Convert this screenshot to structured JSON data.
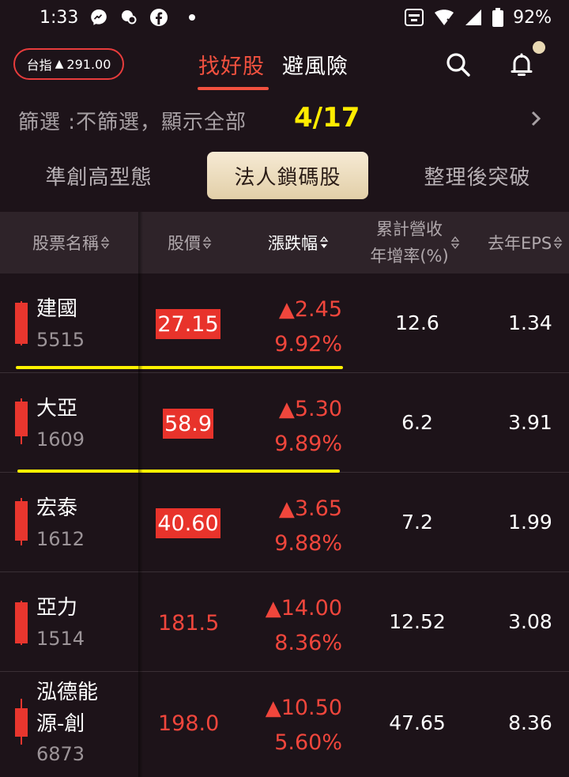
{
  "status_bar": {
    "time": "1:33",
    "battery": "92%"
  },
  "top_nav": {
    "index_label": "台指",
    "index_arrow": "▲",
    "index_value": "291.00",
    "tabs": [
      {
        "label": "找好股",
        "active": true
      },
      {
        "label": "避風險",
        "active": false
      }
    ]
  },
  "filter": {
    "label": "篩選 :不篩選，顯示全部",
    "date": "4/17"
  },
  "sub_tabs": [
    {
      "label": "準創高型態",
      "active": false
    },
    {
      "label": "法人鎖碼股",
      "active": true
    },
    {
      "label": "整理後突破",
      "active": false
    }
  ],
  "table": {
    "headers": {
      "name": "股票名稱",
      "price": "股價",
      "change": "漲跌幅",
      "revenue_line1": "累計營收",
      "revenue_line2": "年增率(%)",
      "eps": "去年EPS"
    },
    "rows": [
      {
        "name": "建國",
        "code": "5515",
        "price": "27.15",
        "price_limit_up": true,
        "change": "2.45",
        "change_pct": "9.92%",
        "revenue_growth": "12.6",
        "eps": "1.34"
      },
      {
        "name": "大亞",
        "code": "1609",
        "price": "58.9",
        "price_limit_up": true,
        "change": "5.30",
        "change_pct": "9.89%",
        "revenue_growth": "6.2",
        "eps": "3.91"
      },
      {
        "name": "宏泰",
        "code": "1612",
        "price": "40.60",
        "price_limit_up": true,
        "change": "3.65",
        "change_pct": "9.88%",
        "revenue_growth": "7.2",
        "eps": "1.99"
      },
      {
        "name": "亞力",
        "code": "1514",
        "price": "181.5",
        "price_limit_up": false,
        "change": "14.00",
        "change_pct": "8.36%",
        "revenue_growth": "12.52",
        "eps": "3.08"
      },
      {
        "name_line1": "泓德能",
        "name_line2": "源-創",
        "code": "6873",
        "price": "198.0",
        "price_limit_up": false,
        "change": "10.50",
        "change_pct": "5.60%",
        "revenue_growth": "47.65",
        "eps": "8.36"
      }
    ]
  },
  "colors": {
    "up_red": "#e8332b",
    "accent_tab": "#f2513f",
    "highlight_yellow": "#fff200",
    "date_yellow": "#ffec00",
    "background": "#1d1319"
  }
}
